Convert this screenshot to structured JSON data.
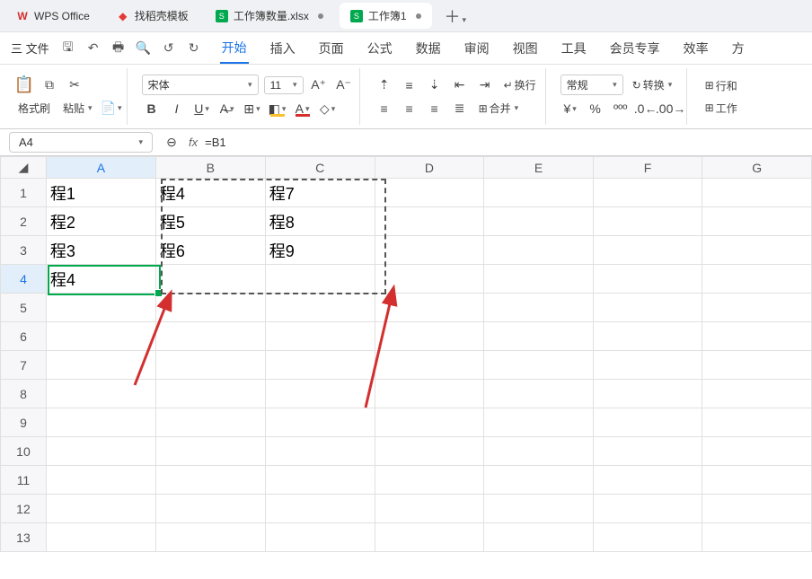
{
  "tabs": {
    "app": "WPS Office",
    "template": "找稻壳模板",
    "file1": "工作簿数量.xlsx",
    "file2": "工作簿1"
  },
  "menu": {
    "file": "三 文件",
    "items": [
      "开始",
      "插入",
      "页面",
      "公式",
      "数据",
      "审阅",
      "视图",
      "工具",
      "会员专享",
      "效率",
      "方"
    ],
    "active_index": 0
  },
  "ribbon": {
    "format_brush": "格式刷",
    "paste": "粘贴",
    "font_name": "宋体",
    "font_size": "11",
    "number_format": "常规",
    "convert": "转换",
    "wrap_text": "换行",
    "merge": "合并",
    "row_col": "行和",
    "worksheet": "工作"
  },
  "formula_bar": {
    "name_box": "A4",
    "formula": "=B1"
  },
  "grid": {
    "columns": [
      "A",
      "B",
      "C",
      "D",
      "E",
      "F",
      "G"
    ],
    "rows": [
      1,
      2,
      3,
      4,
      5,
      6,
      7,
      8,
      9,
      10,
      11,
      12,
      13
    ],
    "cells": {
      "A1": "程1",
      "B1": "程4",
      "C1": "程7",
      "A2": "程2",
      "B2": "程5",
      "C2": "程8",
      "A3": "程3",
      "B3": "程6",
      "C3": "程9",
      "A4": "程4"
    },
    "active_cell": "A4"
  }
}
